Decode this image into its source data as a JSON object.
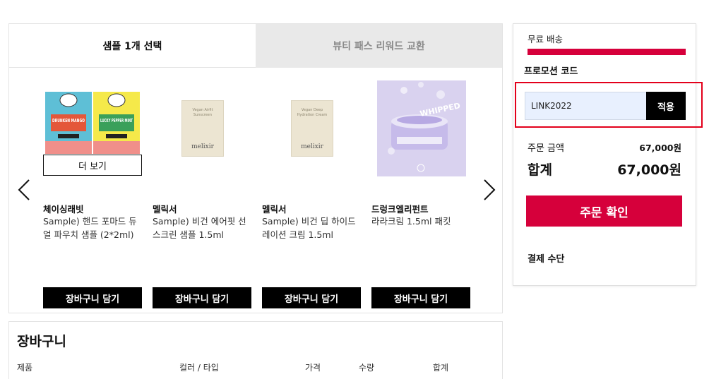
{
  "tabs": [
    {
      "label": "샘플 1개 선택"
    },
    {
      "label": "뷰티 패스 리워드 교환"
    }
  ],
  "more_button": "더 보기",
  "products": [
    {
      "brand": "체이싱래빗",
      "name": "Sample) 핸드 포마드 듀얼 파우치 샘플 (2*2ml)",
      "art": {
        "left_text": "DRUNKEN MANGO",
        "right_text": "LUCKY PEPPER MINT"
      },
      "cart_label": "장바구니 담기"
    },
    {
      "brand": "멜릭서",
      "name": "Sample) 비건 에어핏 선 스크린 샘플 1.5ml",
      "art": {
        "pouch_text": "Vegan Airfit Sunscreen",
        "logo": "melixir"
      },
      "cart_label": "장바구니 담기"
    },
    {
      "brand": "멜릭서",
      "name": "Sample) 비건 딥 하이드 레이션 크림 1.5ml",
      "art": {
        "pouch_text": "Vegan Deep Hydration Cream",
        "logo": "melixir"
      },
      "cart_label": "장바구니 담기"
    },
    {
      "brand": "드렁크엘리펀트",
      "name": "라라크림 1.5ml 패킷",
      "art": {
        "label": "WHIPPED"
      },
      "cart_label": "장바구니 담기"
    }
  ],
  "cart": {
    "title": "장바구니",
    "columns": [
      "제품",
      "컬러 / 타입",
      "가격",
      "수량",
      "합계"
    ]
  },
  "summary": {
    "free_shipping": "무료 배송",
    "promo_label": "프로모션 코드",
    "promo_value": "LINK2022",
    "apply_label": "적용",
    "order_amount_label": "주문 금액",
    "order_amount_value": "67,000원",
    "total_label": "합계",
    "total_value": "67,000원",
    "confirm_label": "주문 확인",
    "payment_label": "결제 수단"
  },
  "colors": {
    "accent": "#d6003b",
    "highlight_border": "#e3001b"
  }
}
